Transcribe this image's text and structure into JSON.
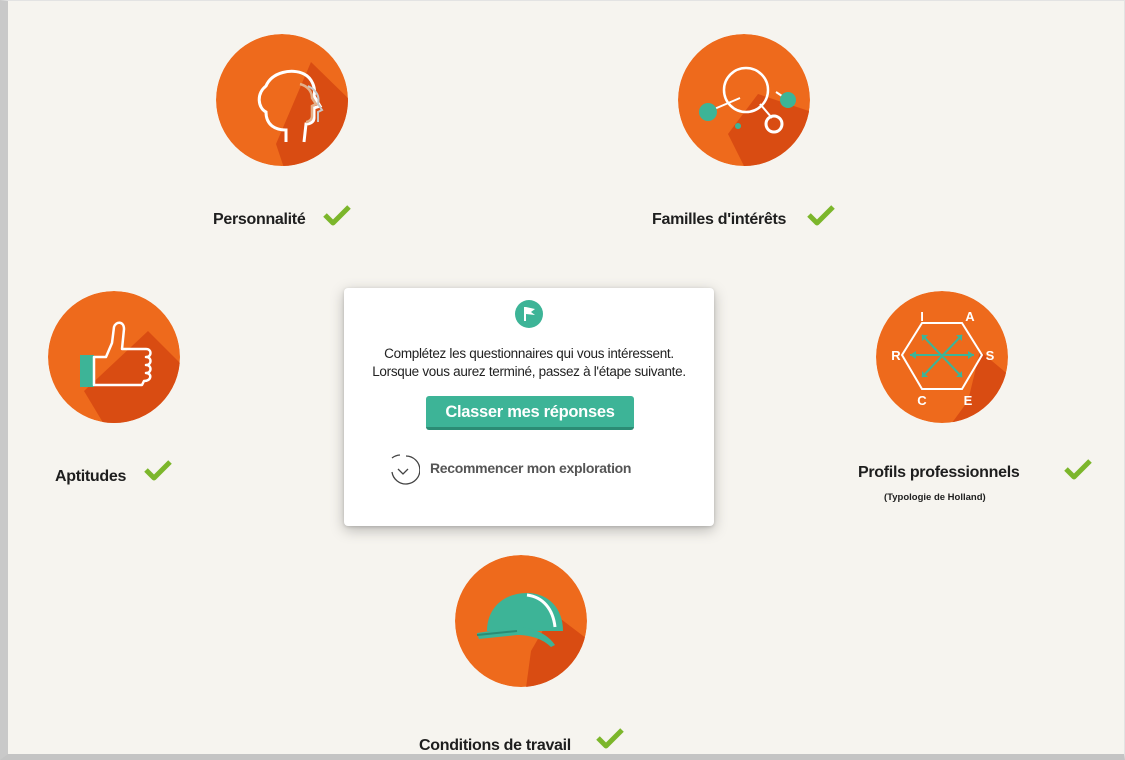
{
  "colors": {
    "orange": "#ee6a1c",
    "orange_shadow": "#d94c12",
    "teal": "#3db497",
    "check_green": "#7cb62b",
    "background": "#f6f4ef"
  },
  "modules": {
    "personnalite": {
      "label": "Personnalité",
      "icon": "head-profiles-icon",
      "completed": true
    },
    "familles": {
      "label": "Familles d'intérêts",
      "icon": "interest-bubbles-icon",
      "completed": true
    },
    "aptitudes": {
      "label": "Aptitudes",
      "icon": "thumbs-up-icon",
      "completed": true
    },
    "profils": {
      "label": "Profils professionnels",
      "sublabel": "(Typologie de Holland)",
      "icon": "holland-hexagon-icon",
      "hexagon_letters": {
        "top_left": "I",
        "top_right": "A",
        "left": "R",
        "right": "S",
        "bottom_left": "C",
        "bottom_right": "E"
      },
      "completed": true
    },
    "conditions": {
      "label": "Conditions de travail",
      "icon": "hard-hat-icon",
      "completed": true
    }
  },
  "panel": {
    "icon": "flag-icon",
    "line1": "Complétez les questionnaires qui vous intéressent.",
    "line2": "Lorsque vous aurez terminé, passez à l'étape suivante.",
    "primary_button": "Classer mes réponses",
    "restart_link": "Recommencer mon exploration"
  }
}
